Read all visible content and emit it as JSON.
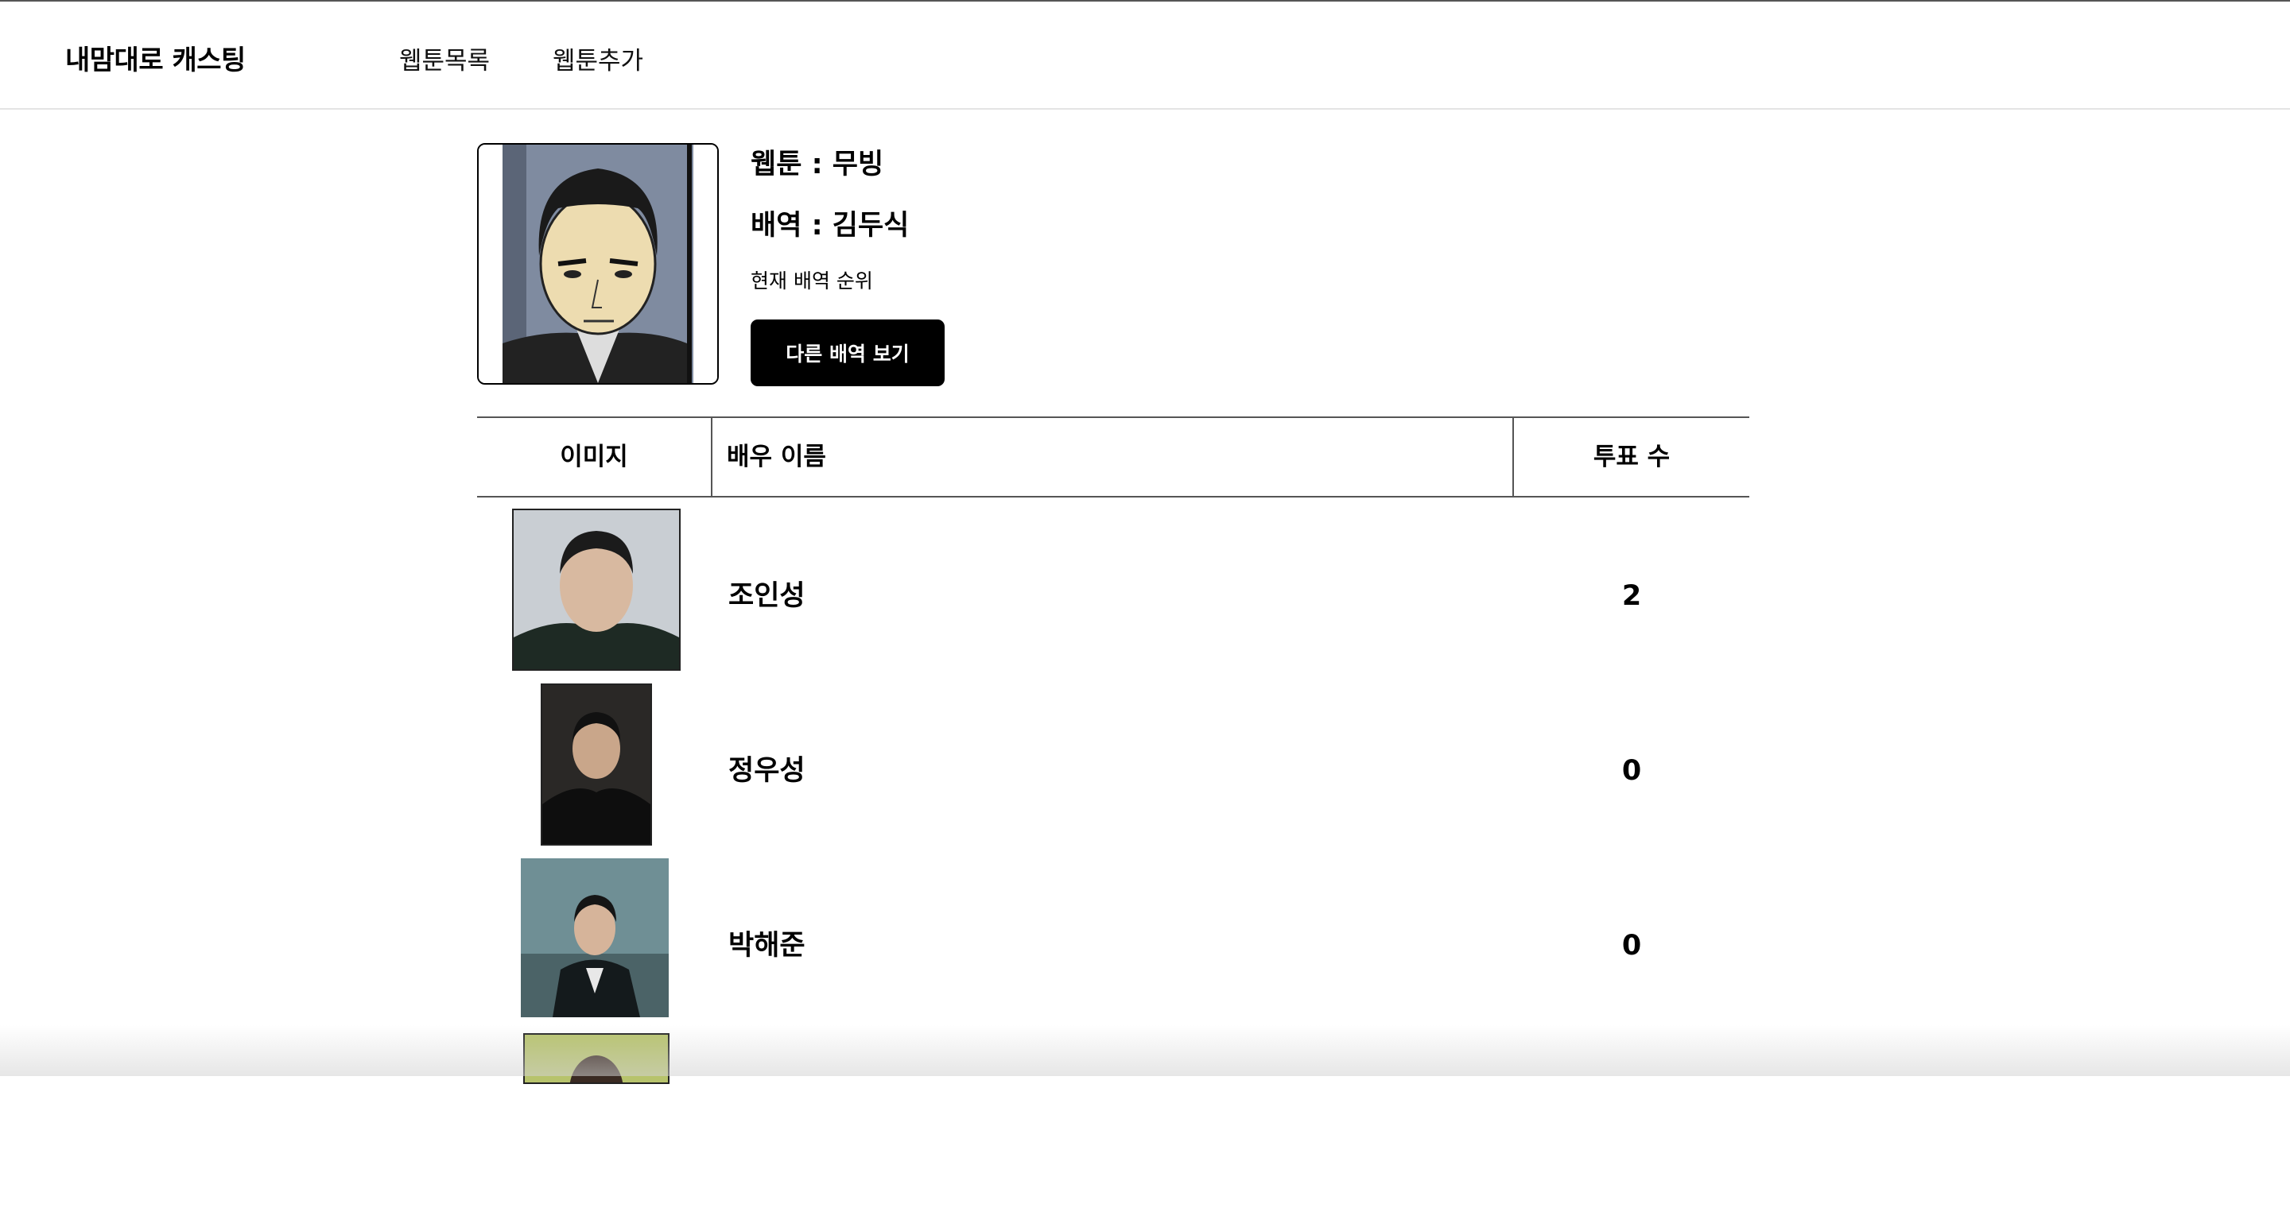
{
  "header": {
    "brand": "내맘대로 캐스팅",
    "nav": {
      "list": "웹툰목록",
      "add": "웹툰추가"
    }
  },
  "role": {
    "webtoon_line": "웹툰 : 무빙",
    "role_line": "배역 : 김두식",
    "rank_caption": "현재 배역 순위",
    "other_button": "다른 배역 보기"
  },
  "table": {
    "headers": {
      "image": "이미지",
      "name": "배우 이름",
      "votes": "투표 수"
    },
    "rows": [
      {
        "name": "조인성",
        "votes": "2"
      },
      {
        "name": "정우성",
        "votes": "0"
      },
      {
        "name": "박해준",
        "votes": "0"
      }
    ]
  }
}
